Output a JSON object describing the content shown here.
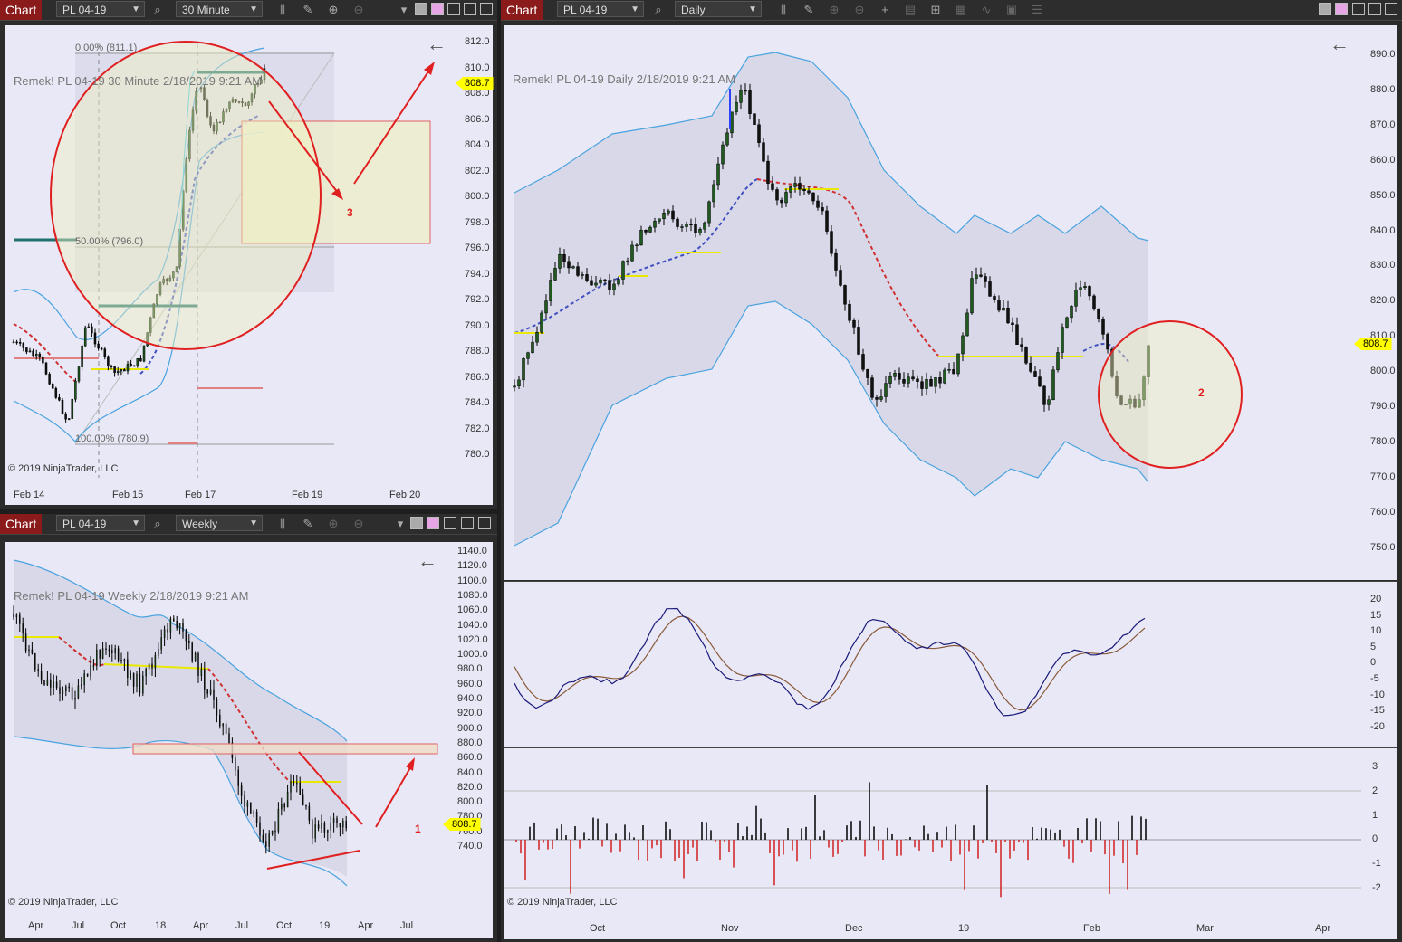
{
  "colors": {
    "bg": "#e8e8f6",
    "chart_btn": "#8b1a1a",
    "band": "#4aa3df",
    "price_tag": "#ffff00",
    "annot": "#e02020"
  },
  "copyright": "© 2019 NinjaTrader, LLC",
  "chart_label": "Chart",
  "last_price": "808.7",
  "tl": {
    "instrument": "PL 04-19",
    "interval": "30 Minute",
    "title": "Remek!  PL 04-19  30 Minute  2/18/2019 9:21 AM",
    "yticks": [
      "812.0",
      "810.0",
      "808.0",
      "806.0",
      "804.0",
      "802.0",
      "800.0",
      "798.0",
      "796.0",
      "794.0",
      "792.0",
      "790.0",
      "788.0",
      "786.0",
      "784.0",
      "782.0",
      "780.0"
    ],
    "xticks": [
      "Feb 14",
      "Feb 15",
      "Feb 17",
      "Feb 19",
      "Feb 20"
    ],
    "fib": [
      "0.00% (811.1)",
      "50.00% (796.0)",
      "100.00% (780.9)"
    ],
    "annotation": "3"
  },
  "bl": {
    "instrument": "PL 04-19",
    "interval": "Weekly",
    "title": "Remek!  PL 04-19  Weekly  2/18/2019 9:21 AM",
    "yticks": [
      "1140.0",
      "1120.0",
      "1100.0",
      "1080.0",
      "1060.0",
      "1040.0",
      "1020.0",
      "1000.0",
      "980.0",
      "960.0",
      "940.0",
      "920.0",
      "900.0",
      "880.0",
      "860.0",
      "840.0",
      "820.0",
      "800.0",
      "780.0",
      "760.0",
      "740.0"
    ],
    "xticks": [
      "Apr",
      "Jul",
      "Oct",
      "18",
      "Apr",
      "Jul",
      "Oct",
      "19",
      "Apr",
      "Jul"
    ],
    "annotation": "1"
  },
  "r": {
    "instrument": "PL 04-19",
    "interval": "Daily",
    "title": "Remek!  PL 04-19  Daily  2/18/2019 9:21 AM",
    "yticks": [
      "890.0",
      "880.0",
      "870.0",
      "860.0",
      "850.0",
      "840.0",
      "830.0",
      "820.0",
      "810.0",
      "800.0",
      "790.0",
      "780.0",
      "770.0",
      "760.0",
      "750.0"
    ],
    "osc_ticks": [
      "20",
      "15",
      "10",
      "5",
      "0",
      "-5",
      "-10",
      "-15",
      "-20"
    ],
    "vol_ticks": [
      "3",
      "2",
      "1",
      "0",
      "-1",
      "-2"
    ],
    "xticks": [
      "Oct",
      "Nov",
      "Dec",
      "19",
      "Feb",
      "Mar",
      "Apr"
    ],
    "annotation": "2"
  }
}
